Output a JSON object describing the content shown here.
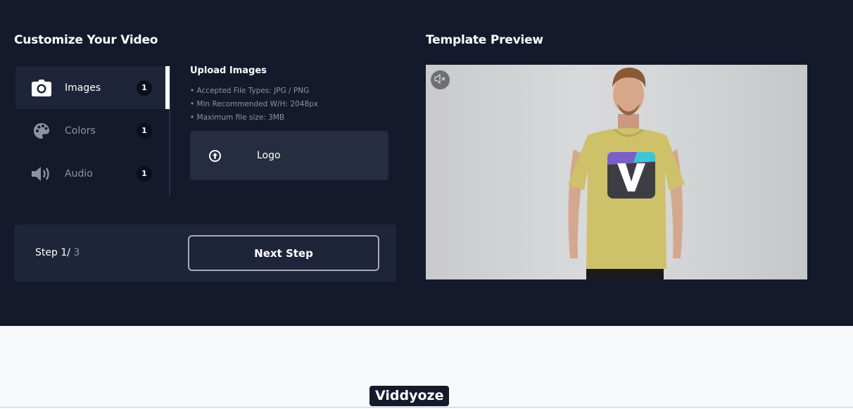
{
  "customize": {
    "title": "Customize Your Video"
  },
  "tabs": [
    {
      "label": "Images",
      "count": "1",
      "icon": "camera-icon",
      "active": true
    },
    {
      "label": "Colors",
      "count": "1",
      "icon": "palette-icon",
      "active": false
    },
    {
      "label": "Audio",
      "count": "1",
      "icon": "speaker-icon",
      "active": false
    }
  ],
  "upload": {
    "title": "Upload Images",
    "requirements": [
      "• Accepted File Types: JPG / PNG",
      "• Min Recommended W/H: 2048px",
      "• Maximum file size: 3MB"
    ],
    "logo_label": "Logo"
  },
  "step": {
    "label": "Step",
    "current": "1",
    "separator": "/",
    "total": "3",
    "next_label": "Next Step"
  },
  "preview": {
    "title": "Template Preview",
    "mute_icon": "mute-icon"
  },
  "footer": {
    "brand": "Viddyoze"
  },
  "colors": {
    "background": "#141a2c",
    "panel": "#1e2538",
    "accent": "#ffffff"
  }
}
